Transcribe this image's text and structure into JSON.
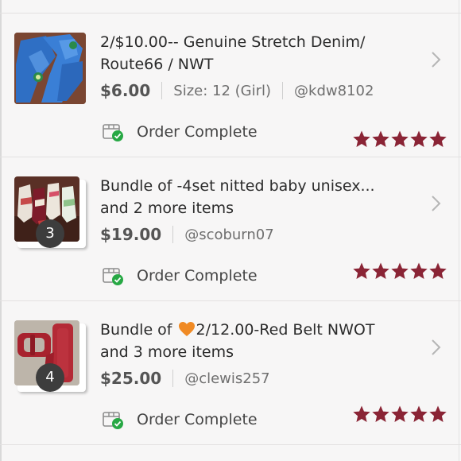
{
  "orders": [
    {
      "title": "2/$10.00-- Genuine Stretch Denim/ Route66 / NWT",
      "price": "$6.00",
      "size": "Size: 12 (Girl)",
      "seller": "@kdw8102",
      "status": "Order Complete",
      "rating": 5,
      "thumbnail": "blue-denim-jeans"
    },
    {
      "title": "Bundle of -4set nitted baby unisex...",
      "title_line2": "and 2 more items",
      "price": "$19.00",
      "seller": "@scoburn07",
      "item_count": "3",
      "status": "Order Complete",
      "rating": 5,
      "thumbnail": "baby-socks-set"
    },
    {
      "title_prefix": "Bundle of ",
      "title_emoji": "orange-heart",
      "title_rest": "2/12.00-Red Belt NWOT",
      "title_line2": "and 3 more items",
      "price": "$25.00",
      "seller": "@clewis257",
      "item_count": "4",
      "status": "Order Complete",
      "rating": 5,
      "thumbnail": "red-belt"
    }
  ],
  "colors": {
    "star": "#8a2435",
    "check_badge": "#27a844",
    "count_badge": "#3d3d3d",
    "heart": "#f08a24"
  },
  "icons": {
    "chevron": "chevron-right-icon",
    "status": "package-check-icon",
    "star": "star-icon"
  }
}
